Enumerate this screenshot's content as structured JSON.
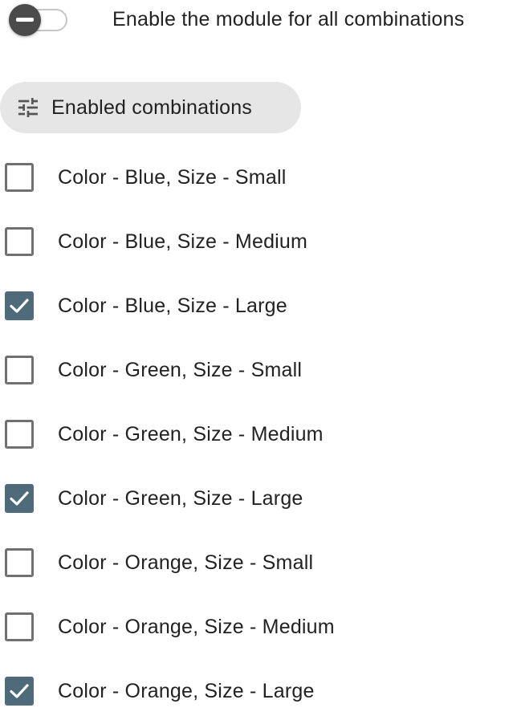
{
  "module_toggle": {
    "label": "Enable the module for all combinations",
    "state": "off"
  },
  "filter_chip": {
    "icon": "tune-sliders-icon",
    "label": "Enabled combinations"
  },
  "combinations": [
    {
      "label": "Color - Blue, Size - Small",
      "checked": false
    },
    {
      "label": "Color - Blue, Size - Medium",
      "checked": false
    },
    {
      "label": "Color - Blue, Size - Large",
      "checked": true
    },
    {
      "label": "Color - Green, Size - Small",
      "checked": false
    },
    {
      "label": "Color - Green, Size - Medium",
      "checked": false
    },
    {
      "label": "Color - Green, Size - Large",
      "checked": true
    },
    {
      "label": "Color - Orange, Size - Small",
      "checked": false
    },
    {
      "label": "Color - Orange, Size - Medium",
      "checked": false
    },
    {
      "label": "Color - Orange, Size - Large",
      "checked": true
    }
  ],
  "colors": {
    "checkbox_checked": "#4f6a7b",
    "checkbox_border": "#707070",
    "chip_background": "#e6e6e6",
    "toggle_knob": "#4b4b4b"
  }
}
